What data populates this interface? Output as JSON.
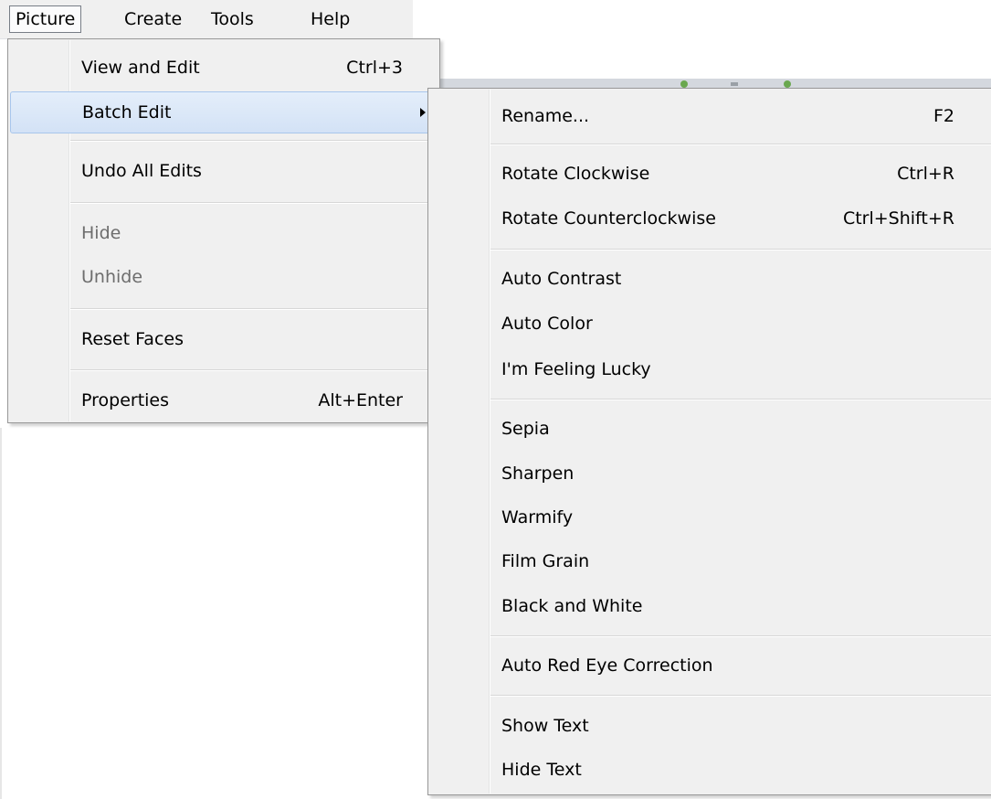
{
  "menubar": {
    "items": [
      {
        "label": "Picture"
      },
      {
        "label": "Create"
      },
      {
        "label": "Tools"
      },
      {
        "label": "Help"
      }
    ]
  },
  "picture_menu": {
    "items": [
      {
        "label": "View and Edit",
        "shortcut": "Ctrl+3"
      },
      {
        "label": "Batch Edit",
        "shortcut": ""
      },
      {
        "label": "Undo All Edits",
        "shortcut": ""
      },
      {
        "label": "Hide",
        "shortcut": ""
      },
      {
        "label": "Unhide",
        "shortcut": ""
      },
      {
        "label": "Reset Faces",
        "shortcut": ""
      },
      {
        "label": "Properties",
        "shortcut": "Alt+Enter"
      }
    ]
  },
  "batch_edit_menu": {
    "items": [
      {
        "label": "Rename...",
        "shortcut": "F2"
      },
      {
        "label": "Rotate Clockwise",
        "shortcut": "Ctrl+R"
      },
      {
        "label": "Rotate Counterclockwise",
        "shortcut": "Ctrl+Shift+R"
      },
      {
        "label": "Auto Contrast",
        "shortcut": ""
      },
      {
        "label": "Auto Color",
        "shortcut": ""
      },
      {
        "label": "I'm Feeling Lucky",
        "shortcut": ""
      },
      {
        "label": "Sepia",
        "shortcut": ""
      },
      {
        "label": "Sharpen",
        "shortcut": ""
      },
      {
        "label": "Warmify",
        "shortcut": ""
      },
      {
        "label": "Film Grain",
        "shortcut": ""
      },
      {
        "label": "Black and White",
        "shortcut": ""
      },
      {
        "label": "Auto Red Eye Correction",
        "shortcut": ""
      },
      {
        "label": "Show Text",
        "shortcut": ""
      },
      {
        "label": "Hide Text",
        "shortcut": ""
      }
    ]
  },
  "colors": {
    "menu_background": "#f0f0f0",
    "highlight_border": "#a8c6ec",
    "highlight_fill": "#dce8f8",
    "disabled_text": "#6d6d6d",
    "toolbar_glyph": "#6aa84f"
  }
}
